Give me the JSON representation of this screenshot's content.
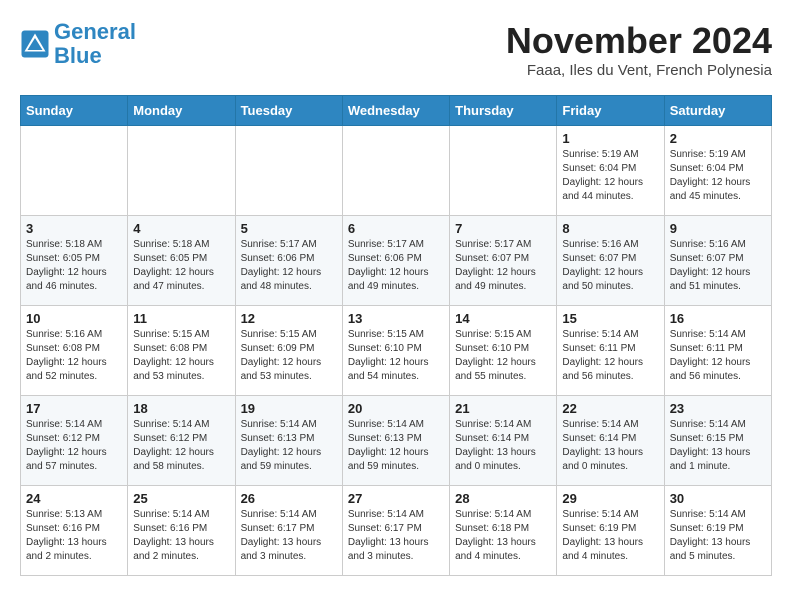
{
  "logo": {
    "line1": "General",
    "line2": "Blue"
  },
  "title": "November 2024",
  "subtitle": "Faaa, Iles du Vent, French Polynesia",
  "headers": [
    "Sunday",
    "Monday",
    "Tuesday",
    "Wednesday",
    "Thursday",
    "Friday",
    "Saturday"
  ],
  "weeks": [
    [
      {
        "day": "",
        "info": ""
      },
      {
        "day": "",
        "info": ""
      },
      {
        "day": "",
        "info": ""
      },
      {
        "day": "",
        "info": ""
      },
      {
        "day": "",
        "info": ""
      },
      {
        "day": "1",
        "info": "Sunrise: 5:19 AM\nSunset: 6:04 PM\nDaylight: 12 hours\nand 44 minutes."
      },
      {
        "day": "2",
        "info": "Sunrise: 5:19 AM\nSunset: 6:04 PM\nDaylight: 12 hours\nand 45 minutes."
      }
    ],
    [
      {
        "day": "3",
        "info": "Sunrise: 5:18 AM\nSunset: 6:05 PM\nDaylight: 12 hours\nand 46 minutes."
      },
      {
        "day": "4",
        "info": "Sunrise: 5:18 AM\nSunset: 6:05 PM\nDaylight: 12 hours\nand 47 minutes."
      },
      {
        "day": "5",
        "info": "Sunrise: 5:17 AM\nSunset: 6:06 PM\nDaylight: 12 hours\nand 48 minutes."
      },
      {
        "day": "6",
        "info": "Sunrise: 5:17 AM\nSunset: 6:06 PM\nDaylight: 12 hours\nand 49 minutes."
      },
      {
        "day": "7",
        "info": "Sunrise: 5:17 AM\nSunset: 6:07 PM\nDaylight: 12 hours\nand 49 minutes."
      },
      {
        "day": "8",
        "info": "Sunrise: 5:16 AM\nSunset: 6:07 PM\nDaylight: 12 hours\nand 50 minutes."
      },
      {
        "day": "9",
        "info": "Sunrise: 5:16 AM\nSunset: 6:07 PM\nDaylight: 12 hours\nand 51 minutes."
      }
    ],
    [
      {
        "day": "10",
        "info": "Sunrise: 5:16 AM\nSunset: 6:08 PM\nDaylight: 12 hours\nand 52 minutes."
      },
      {
        "day": "11",
        "info": "Sunrise: 5:15 AM\nSunset: 6:08 PM\nDaylight: 12 hours\nand 53 minutes."
      },
      {
        "day": "12",
        "info": "Sunrise: 5:15 AM\nSunset: 6:09 PM\nDaylight: 12 hours\nand 53 minutes."
      },
      {
        "day": "13",
        "info": "Sunrise: 5:15 AM\nSunset: 6:10 PM\nDaylight: 12 hours\nand 54 minutes."
      },
      {
        "day": "14",
        "info": "Sunrise: 5:15 AM\nSunset: 6:10 PM\nDaylight: 12 hours\nand 55 minutes."
      },
      {
        "day": "15",
        "info": "Sunrise: 5:14 AM\nSunset: 6:11 PM\nDaylight: 12 hours\nand 56 minutes."
      },
      {
        "day": "16",
        "info": "Sunrise: 5:14 AM\nSunset: 6:11 PM\nDaylight: 12 hours\nand 56 minutes."
      }
    ],
    [
      {
        "day": "17",
        "info": "Sunrise: 5:14 AM\nSunset: 6:12 PM\nDaylight: 12 hours\nand 57 minutes."
      },
      {
        "day": "18",
        "info": "Sunrise: 5:14 AM\nSunset: 6:12 PM\nDaylight: 12 hours\nand 58 minutes."
      },
      {
        "day": "19",
        "info": "Sunrise: 5:14 AM\nSunset: 6:13 PM\nDaylight: 12 hours\nand 59 minutes."
      },
      {
        "day": "20",
        "info": "Sunrise: 5:14 AM\nSunset: 6:13 PM\nDaylight: 12 hours\nand 59 minutes."
      },
      {
        "day": "21",
        "info": "Sunrise: 5:14 AM\nSunset: 6:14 PM\nDaylight: 13 hours\nand 0 minutes."
      },
      {
        "day": "22",
        "info": "Sunrise: 5:14 AM\nSunset: 6:14 PM\nDaylight: 13 hours\nand 0 minutes."
      },
      {
        "day": "23",
        "info": "Sunrise: 5:14 AM\nSunset: 6:15 PM\nDaylight: 13 hours\nand 1 minute."
      }
    ],
    [
      {
        "day": "24",
        "info": "Sunrise: 5:13 AM\nSunset: 6:16 PM\nDaylight: 13 hours\nand 2 minutes."
      },
      {
        "day": "25",
        "info": "Sunrise: 5:14 AM\nSunset: 6:16 PM\nDaylight: 13 hours\nand 2 minutes."
      },
      {
        "day": "26",
        "info": "Sunrise: 5:14 AM\nSunset: 6:17 PM\nDaylight: 13 hours\nand 3 minutes."
      },
      {
        "day": "27",
        "info": "Sunrise: 5:14 AM\nSunset: 6:17 PM\nDaylight: 13 hours\nand 3 minutes."
      },
      {
        "day": "28",
        "info": "Sunrise: 5:14 AM\nSunset: 6:18 PM\nDaylight: 13 hours\nand 4 minutes."
      },
      {
        "day": "29",
        "info": "Sunrise: 5:14 AM\nSunset: 6:19 PM\nDaylight: 13 hours\nand 4 minutes."
      },
      {
        "day": "30",
        "info": "Sunrise: 5:14 AM\nSunset: 6:19 PM\nDaylight: 13 hours\nand 5 minutes."
      }
    ]
  ]
}
